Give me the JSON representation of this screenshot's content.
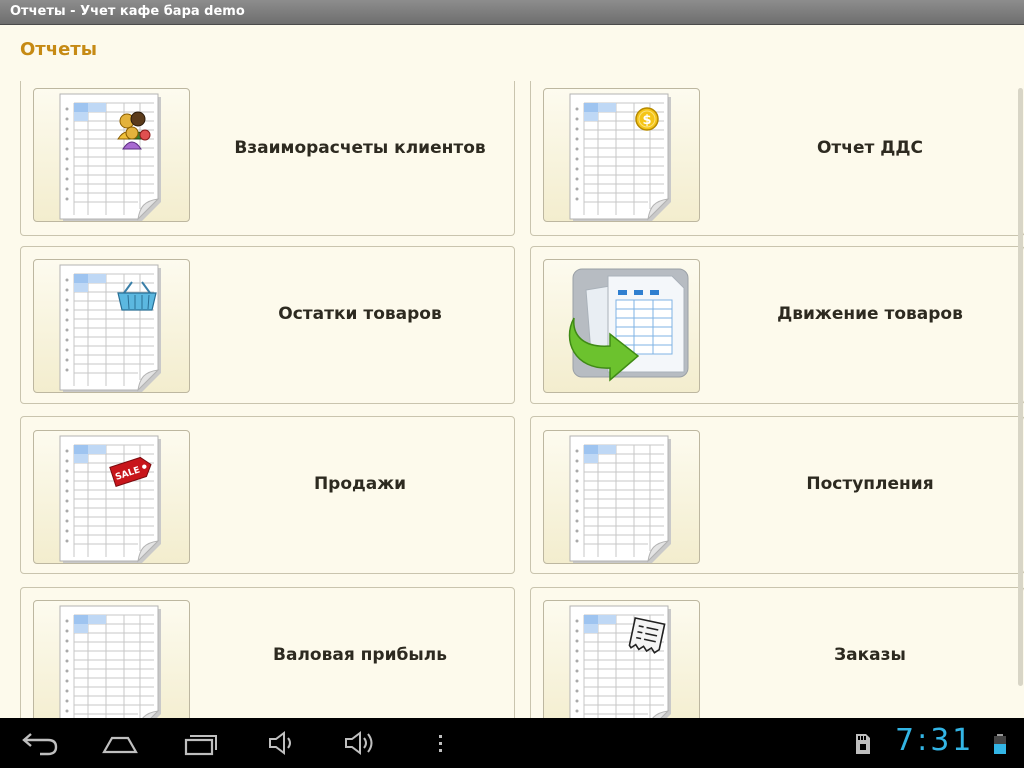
{
  "window": {
    "title": "Отчеты - Учет кафе бара demo"
  },
  "page": {
    "title": "Отчеты"
  },
  "reports": [
    {
      "label": "Взаиморасчеты клиентов",
      "icon": "clients-icon"
    },
    {
      "label": "Отчет ДДС",
      "icon": "money-coin-icon"
    },
    {
      "label": "Остатки товаров",
      "icon": "basket-icon"
    },
    {
      "label": "Движение товаров",
      "icon": "goods-movement-arrow-icon"
    },
    {
      "label": "Продажи",
      "icon": "sale-tag-icon"
    },
    {
      "label": "Поступления",
      "icon": "spreadsheet-icon"
    },
    {
      "label": "Валовая прибыль",
      "icon": "spreadsheet-icon"
    },
    {
      "label": "Заказы",
      "icon": "receipt-icon"
    }
  ],
  "statusbar": {
    "clock": "7:31"
  },
  "colors": {
    "accent_title": "#c68a14",
    "background": "#fdfaec",
    "clock": "#33b5e5"
  }
}
